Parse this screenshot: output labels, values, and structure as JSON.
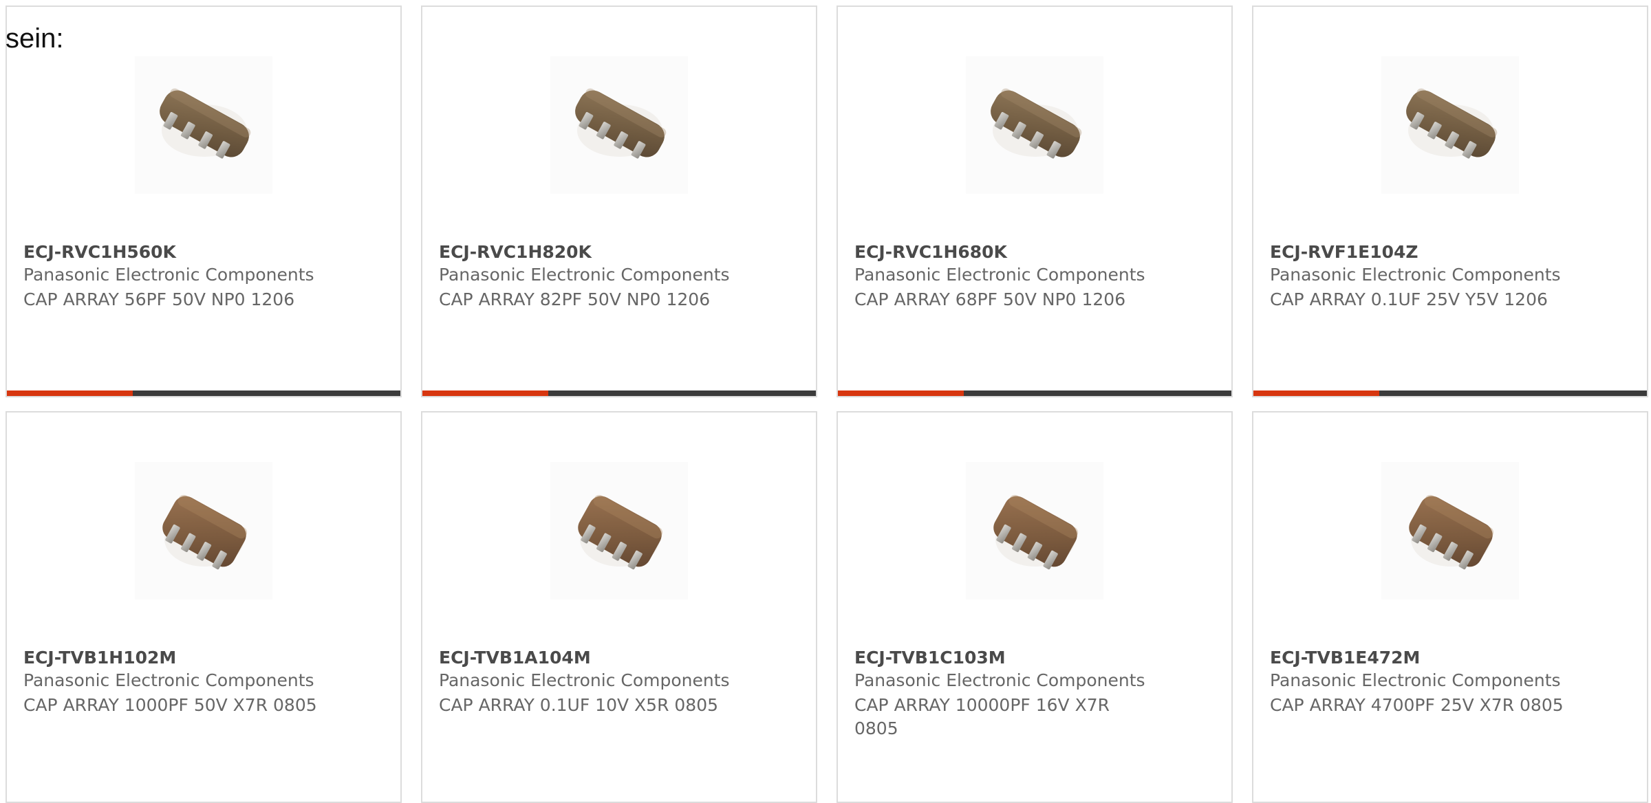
{
  "intro_text": "sein:",
  "colors": {
    "accent_bar": "#d7360f",
    "track_bar": "#3b3b3b",
    "card_border": "#dcdcdc",
    "title_text": "#4a4a4a",
    "body_text": "#666666"
  },
  "products": [
    {
      "part_number": "ECJ-RVC1H560K",
      "manufacturer": "Panasonic Electronic Components",
      "description": "CAP ARRAY 56PF 50V NP0 1206",
      "image_icon": "capacitor-array-icon",
      "bar_fill_fraction": 0.32
    },
    {
      "part_number": "ECJ-RVC1H820K",
      "manufacturer": "Panasonic Electronic Components",
      "description": "CAP ARRAY 82PF 50V NP0 1206",
      "image_icon": "capacitor-array-icon",
      "bar_fill_fraction": 0.32
    },
    {
      "part_number": "ECJ-RVC1H680K",
      "manufacturer": "Panasonic Electronic Components",
      "description": "CAP ARRAY 68PF 50V NP0 1206",
      "image_icon": "capacitor-array-icon",
      "bar_fill_fraction": 0.32
    },
    {
      "part_number": "ECJ-RVF1E104Z",
      "manufacturer": "Panasonic Electronic Components",
      "description": "CAP ARRAY 0.1UF 25V Y5V 1206",
      "image_icon": "capacitor-array-icon",
      "bar_fill_fraction": 0.32
    },
    {
      "part_number": "ECJ-TVB1H102M",
      "manufacturer": "Panasonic Electronic Components",
      "description": "CAP ARRAY 1000PF 50V X7R 0805",
      "image_icon": "capacitor-array-icon",
      "bar_fill_fraction": 0
    },
    {
      "part_number": "ECJ-TVB1A104M",
      "manufacturer": "Panasonic Electronic Components",
      "description": "CAP ARRAY 0.1UF 10V X5R 0805",
      "image_icon": "capacitor-array-icon",
      "bar_fill_fraction": 0
    },
    {
      "part_number": "ECJ-TVB1C103M",
      "manufacturer": "Panasonic Electronic Components",
      "description": "CAP ARRAY 10000PF 16V X7R 0805",
      "image_icon": "capacitor-array-icon",
      "bar_fill_fraction": 0
    },
    {
      "part_number": "ECJ-TVB1E472M",
      "manufacturer": "Panasonic Electronic Components",
      "description": "CAP ARRAY 4700PF 25V X7R 0805",
      "image_icon": "capacitor-array-icon",
      "bar_fill_fraction": 0
    }
  ]
}
